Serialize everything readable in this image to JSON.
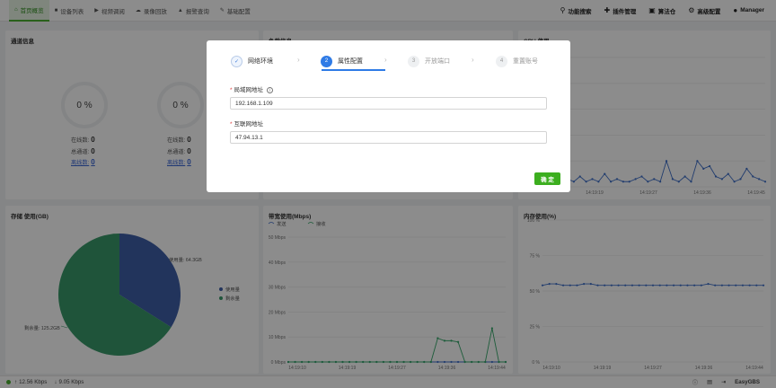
{
  "nav": {
    "left": [
      {
        "label": "首页概览",
        "icon": "home-icon"
      },
      {
        "label": "设备列表",
        "icon": "camera-icon"
      },
      {
        "label": "视频调阅",
        "icon": "play-icon"
      },
      {
        "label": "录像回放",
        "icon": "cloud-icon"
      },
      {
        "label": "报警查询",
        "icon": "alarm-icon"
      },
      {
        "label": "基础配置",
        "icon": "pen-icon"
      }
    ],
    "right": [
      {
        "label": "功能搜索",
        "icon": "search-icon"
      },
      {
        "label": "插件管理",
        "icon": "puzzle-icon"
      },
      {
        "label": "算法仓",
        "icon": "box-icon"
      },
      {
        "label": "高级配置",
        "icon": "gear-icon"
      },
      {
        "label": "Manager",
        "icon": "user-icon"
      }
    ]
  },
  "channel_card": {
    "title": "通道信息",
    "gauges": [
      {
        "value": "0 %",
        "online_label": "在线数:",
        "online": "0",
        "total_label": "总通道:",
        "total": "0",
        "offline_label": "离线数:",
        "offline": "0"
      },
      {
        "value": "0 %",
        "online_label": "在线数:",
        "online": "0",
        "total_label": "总通道:",
        "total": "0",
        "offline_label": "离线数:",
        "offline": "0"
      }
    ]
  },
  "load_card": {
    "title": "负载信息"
  },
  "cpu_card": {
    "title": "CPU 使用"
  },
  "storage_card": {
    "title": "存储 使用(GB)",
    "used_label": "使用量: 64.3GB",
    "free_label": "剩余量: 125.2GB",
    "legend_used": "使用量",
    "legend_free": "剩余量",
    "colors": {
      "used": "#3e5fa8",
      "free": "#3a9a6a"
    }
  },
  "bandwidth_card": {
    "title": "带宽使用(Mbps)",
    "legend_out": "发送",
    "legend_in": "接收"
  },
  "memory_card": {
    "title": "内存使用(%)"
  },
  "bottom": {
    "up": "12.56 Kbps",
    "down": "9.05 Kbps",
    "brand": "EasyGBS"
  },
  "modal": {
    "steps": [
      {
        "num": "✓",
        "label": "网络环境",
        "state": "done"
      },
      {
        "num": "2",
        "label": "属性配置",
        "state": "active"
      },
      {
        "num": "3",
        "label": "开放端口",
        "state": "todo"
      },
      {
        "num": "4",
        "label": "重置账号",
        "state": "todo"
      }
    ],
    "lan_label": "局域网地址",
    "lan_value": "192.168.1.109",
    "wan_label": "互联网地址",
    "wan_value": "47.94.13.1",
    "ok_label": "确 定"
  },
  "chart_data": [
    {
      "type": "pie",
      "title": "存储 使用(GB)",
      "categories": [
        "使用量",
        "剩余量"
      ],
      "values": [
        64.3,
        125.2
      ]
    },
    {
      "type": "line",
      "title": "带宽使用(Mbps)",
      "x_ticks": [
        "14:19:10",
        "14:19:19",
        "14:19:27",
        "14:19:36",
        "14:19:44"
      ],
      "y_ticks": [
        "0 Mbps",
        "10 Mbps",
        "20 Mbps",
        "30 Mbps",
        "40 Mbps",
        "50 Mbps"
      ],
      "ylim": [
        0,
        50
      ],
      "series": [
        {
          "name": "发送",
          "color": "#3e6fc9",
          "values": [
            0,
            0,
            0,
            0,
            0,
            0,
            0,
            0,
            0,
            0,
            0,
            0,
            0,
            0,
            0,
            0,
            0,
            0,
            0,
            0,
            0,
            0,
            0,
            0,
            0,
            0,
            0,
            0,
            0,
            0,
            0,
            0,
            0
          ]
        },
        {
          "name": "接收",
          "color": "#35a86a",
          "values": [
            0,
            0,
            0,
            0,
            0,
            0,
            0,
            0,
            0,
            0,
            0,
            0,
            0,
            0,
            0,
            0,
            0,
            0,
            0,
            0,
            0,
            0,
            9.5,
            8.5,
            8.5,
            8.0,
            0,
            0,
            0,
            0,
            13.5,
            0,
            0
          ]
        }
      ]
    },
    {
      "type": "line",
      "title": "内存使用(%)",
      "x_ticks": [
        "14:19:10",
        "14:19:19",
        "14:19:27",
        "14:19:36",
        "14:19:44"
      ],
      "y_ticks": [
        "0 %",
        "25 %",
        "50 %",
        "75 %",
        "100 %"
      ],
      "ylim": [
        0,
        100
      ],
      "series": [
        {
          "name": "",
          "color": "#3e6fc9",
          "values": [
            54,
            55,
            55,
            54,
            54,
            54,
            55,
            55,
            54,
            54,
            54,
            54,
            54,
            54,
            54,
            54,
            54,
            54,
            54,
            54,
            54,
            54,
            54,
            54,
            55,
            54,
            54,
            54,
            54,
            54,
            54,
            54,
            54
          ]
        }
      ]
    },
    {
      "type": "line",
      "title": "CPU 使用",
      "x_ticks": [
        "14:19:19",
        "14:19:27",
        "14:19:36",
        "14:19:45"
      ],
      "series": [
        {
          "name": "",
          "color": "#3e6fc9",
          "values": [
            3,
            2,
            4,
            2,
            3,
            2,
            5,
            2,
            3,
            2,
            2,
            3,
            4,
            2,
            3,
            2,
            10,
            3,
            2,
            4,
            2,
            10,
            7,
            8,
            4,
            3,
            5,
            2,
            3,
            7,
            4,
            3,
            2
          ]
        }
      ]
    }
  ]
}
